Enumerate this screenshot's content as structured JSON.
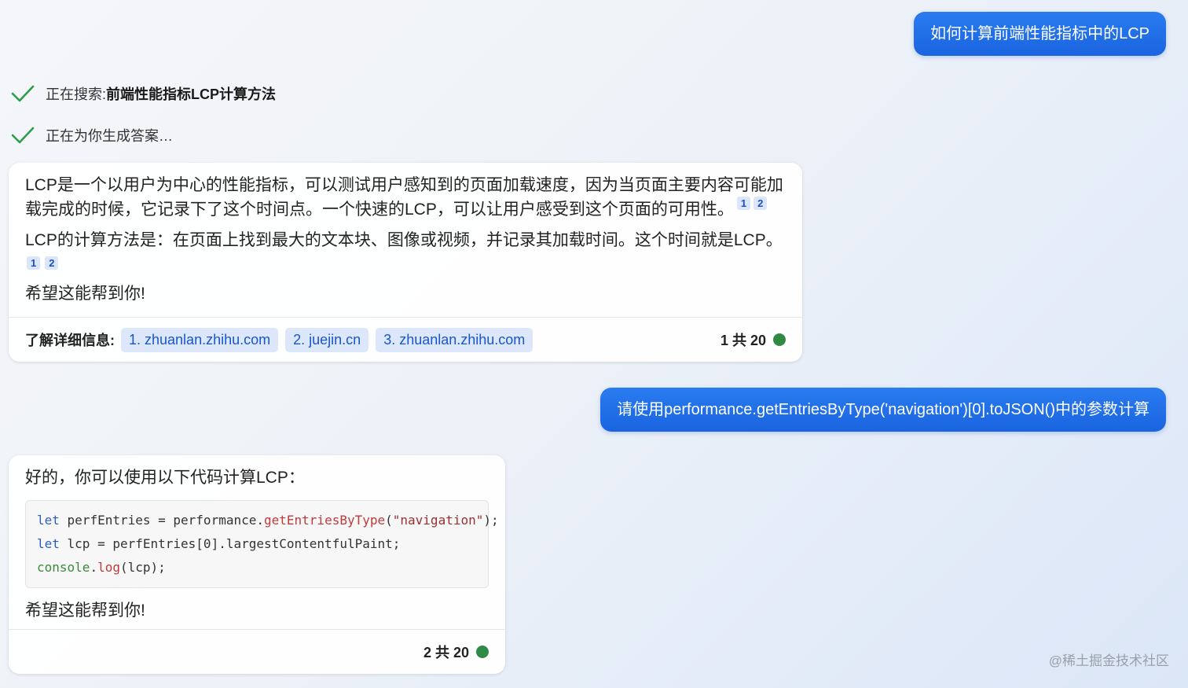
{
  "conversation": {
    "user_message_1": "如何计算前端性能指标中的LCP",
    "status_1_prefix": "正在搜索: ",
    "status_1_query": "前端性能指标LCP计算方法",
    "status_2": "正在为你生成答案…",
    "bot_1": {
      "para1": "LCP是一个以用户为中心的性能指标，可以测试用户感知到的页面加载速度，因为当页面主要内容可能加载完成的时候，它记录下了这个时间点。一个快速的LCP，可以让用户感受到这个页面的可用性。",
      "para1_cites": [
        "1",
        "2"
      ],
      "para2": "LCP的计算方法是：在页面上找到最大的文本块、图像或视频，并记录其加载时间。这个时间就是LCP。",
      "para2_cites": [
        "1",
        "2"
      ],
      "para3": "希望这能帮到你!",
      "learn_more_label": "了解详细信息:",
      "sources": [
        "1. zhuanlan.zhihu.com",
        "2. juejin.cn",
        "3. zhuanlan.zhihu.com"
      ],
      "counter": "1 共 20"
    },
    "user_message_2": "请使用performance.getEntriesByType('navigation')[0].toJSON()中的参数计算",
    "bot_2": {
      "intro": "好的，你可以使用以下代码计算LCP：",
      "code": {
        "line1": {
          "kw": "let",
          "a": " perfEntries = performance.",
          "fn": "getEntriesByType",
          "b": "(",
          "str": "\"navigation\"",
          "c": ");"
        },
        "line2": {
          "kw": "let",
          "a": " lcp = perfEntries[0].largestContentfulPaint;"
        },
        "line3": {
          "obj": "console",
          "a": ".",
          "fn": "log",
          "b": "(lcp);"
        }
      },
      "outro": "希望这能帮到你!",
      "counter": "2 共 20"
    }
  },
  "watermark": "@稀土掘金技术社区",
  "colors": {
    "user_bubble": "#1a64e0",
    "check_green": "#2e9e4a",
    "status_dot": "#2e8b45",
    "source_pill_bg": "#dce7fb",
    "source_pill_text": "#1a56c8"
  },
  "icons": {
    "status_check": "check-icon",
    "counter_dot": "status-dot-icon"
  }
}
